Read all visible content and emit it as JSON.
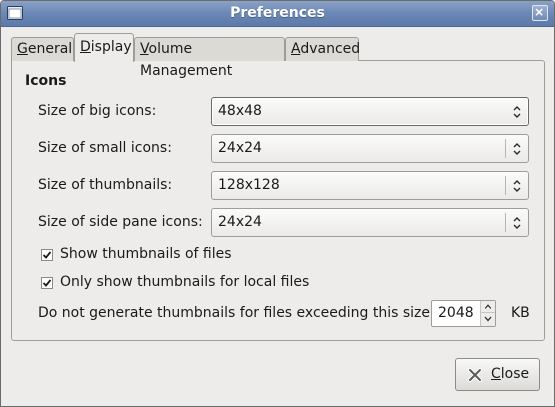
{
  "window": {
    "title": "Preferences"
  },
  "tabs": [
    {
      "label": "General",
      "mnemonic": "G",
      "rest": "eneral"
    },
    {
      "label": "Display",
      "mnemonic": "D",
      "rest": "isplay"
    },
    {
      "label": "Volume Management",
      "mnemonic": "V",
      "rest": "olume Management"
    },
    {
      "label": "Advanced",
      "mnemonic": "A",
      "rest": "dvanced"
    }
  ],
  "active_tab": "Display",
  "icons_section": {
    "title": "Icons",
    "rows": [
      {
        "label": "Size of big icons:",
        "value": "48x48"
      },
      {
        "label": "Size of small icons:",
        "value": "24x24"
      },
      {
        "label": "Size of thumbnails:",
        "value": "128x128"
      },
      {
        "label": "Size of side pane icons:",
        "value": "24x24"
      }
    ]
  },
  "checkboxes": [
    {
      "label": "Show thumbnails of files",
      "checked": true
    },
    {
      "label": "Only show thumbnails for local files",
      "checked": true
    }
  ],
  "threshold": {
    "label": "Do not generate thumbnails for files exceeding this size:",
    "value": "2048",
    "unit": "KB"
  },
  "close_button": {
    "label": "Close",
    "mnemonic": "C",
    "rest": "lose"
  },
  "colors": {
    "titlebar": "#6a87b5",
    "window_bg": "#edeceb"
  },
  "icons": {
    "app": "window-app-icon",
    "titlebar_close": "close-icon",
    "button_close": "close-x-icon",
    "check": "checkmark-icon"
  }
}
